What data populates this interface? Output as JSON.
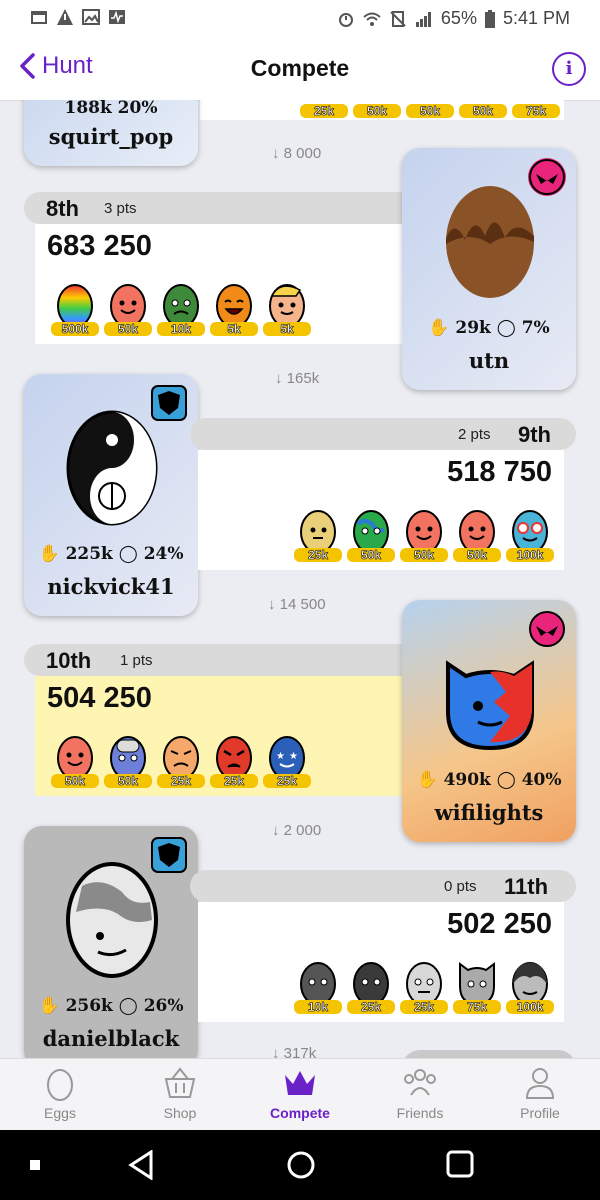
{
  "status": {
    "battery": "65%",
    "time": "5:41 PM"
  },
  "header": {
    "back_label": "Hunt",
    "title": "Compete",
    "info_icon": "i"
  },
  "diffs": {
    "d1": "8 000",
    "d2": "165k",
    "d3": "14 500",
    "d4": "2 000",
    "d5": "317k"
  },
  "top_card": {
    "stats": "188k  20%",
    "username": "squirt_pop",
    "eggs": [
      "25k",
      "50k",
      "50k",
      "50k",
      "75k"
    ]
  },
  "entries": [
    {
      "rank": "8th",
      "pts": "3 pts",
      "score": "683 250",
      "eggs": [
        "500k",
        "50k",
        "10k",
        "5k",
        "5k"
      ],
      "player": {
        "hands": "29k",
        "percent": "7%",
        "username": "utn"
      }
    },
    {
      "rank": "9th",
      "pts": "2 pts",
      "score": "518 750",
      "eggs": [
        "25k",
        "50k",
        "50k",
        "50k",
        "100k"
      ],
      "player": {
        "hands": "225k",
        "percent": "24%",
        "username": "nickvick41"
      }
    },
    {
      "rank": "10th",
      "pts": "1 pts",
      "score": "504 250",
      "eggs": [
        "50k",
        "50k",
        "25k",
        "25k",
        "25k"
      ],
      "player": {
        "hands": "490k",
        "percent": "40%",
        "username": "wifilights"
      }
    },
    {
      "rank": "11th",
      "pts": "0 pts",
      "score": "502 250",
      "eggs": [
        "10k",
        "25k",
        "25k",
        "75k",
        "100k"
      ],
      "player": {
        "hands": "256k",
        "percent": "26%",
        "username": "danielblack"
      }
    }
  ],
  "nav": {
    "eggs": "Eggs",
    "shop": "Shop",
    "compete": "Compete",
    "friends": "Friends",
    "profile": "Profile"
  },
  "colors": {
    "accent": "#6b21c8",
    "highlight_row": "#fef5b3",
    "badge": "#e8257a"
  }
}
